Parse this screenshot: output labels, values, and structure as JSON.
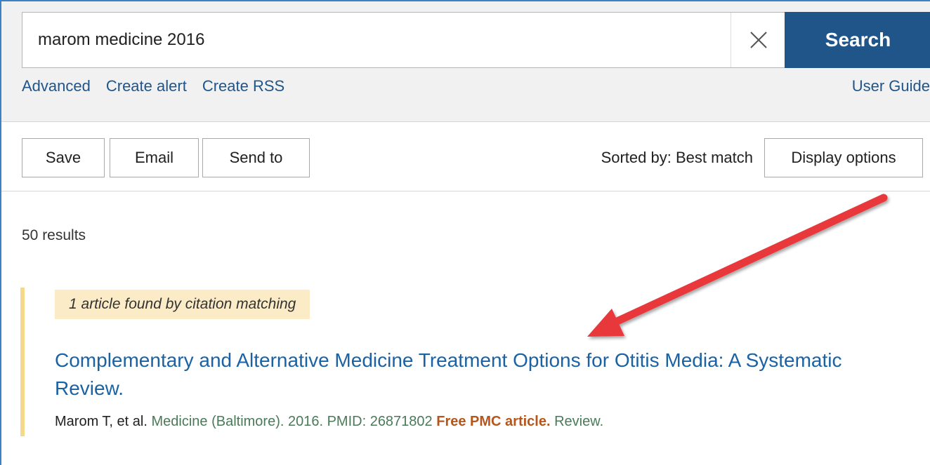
{
  "search": {
    "query": "marom medicine 2016",
    "button_label": "Search",
    "links": [
      "Advanced",
      "Create alert",
      "Create RSS"
    ],
    "user_guide": "User Guide"
  },
  "actions": {
    "save": "Save",
    "email": "Email",
    "send_to": "Send to",
    "sorted_by": "Sorted by: Best match",
    "display_options": "Display options"
  },
  "results": {
    "count": "50 results",
    "citation_match": "1 article found by citation matching",
    "items": [
      {
        "title": "Complementary and Alternative Medicine Treatment Options for Otitis Media: A Systematic Review.",
        "authors": "Marom T, et al.",
        "journal": "Medicine (Baltimore). 2016. PMID: 26871802",
        "free_pmc": "Free PMC article.",
        "type": "Review."
      }
    ]
  },
  "colors": {
    "search_button": "#20558a",
    "link": "#20558a",
    "title_link": "#1a62a4",
    "free_pmc": "#b5561c",
    "citation_badge_bg": "#fbebc6",
    "result_border": "#f4d98b",
    "annotation_arrow": "#e8393a"
  }
}
